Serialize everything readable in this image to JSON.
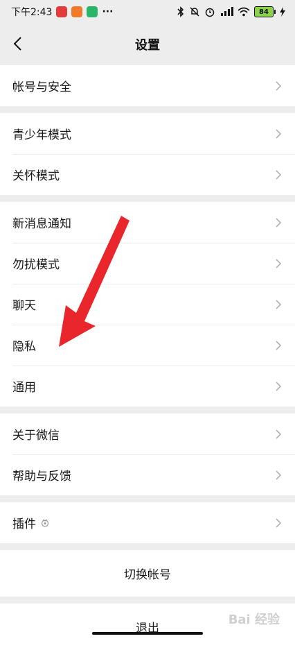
{
  "status": {
    "time": "下午2:43",
    "more": "···",
    "battery": "84"
  },
  "nav": {
    "title": "设置"
  },
  "groups": [
    [
      "帐号与安全"
    ],
    [
      "青少年模式",
      "关怀模式"
    ],
    [
      "新消息通知",
      "勿扰模式",
      "聊天",
      "隐私",
      "通用"
    ],
    [
      "关于微信",
      "帮助与反馈"
    ],
    [
      "插件"
    ]
  ],
  "actions": {
    "switch_account": "切换帐号",
    "logout": "退出"
  },
  "colors": {
    "arrow": "#e8262c",
    "chevron": "#b2b2b2"
  },
  "watermark": "Bai 经验"
}
